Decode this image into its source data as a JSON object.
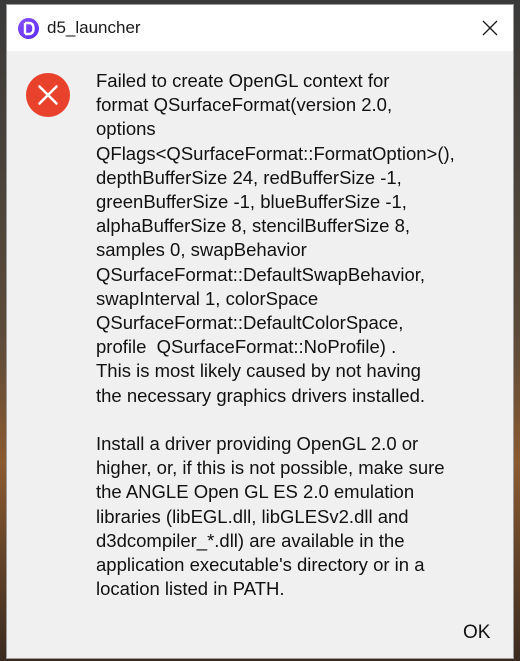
{
  "window": {
    "title": "d5_launcher",
    "app_icon": "d5-launcher-logo-icon",
    "close_icon": "close-icon"
  },
  "dialog": {
    "icon": "error-icon",
    "message_paragraph_1": "Failed to create OpenGL context for\nformat QSurfaceFormat(version 2.0,\noptions\nQFlags<QSurfaceFormat::FormatOption>(),\ndepthBufferSize 24, redBufferSize -1,\ngreenBufferSize -1, blueBufferSize -1,\nalphaBufferSize 8, stencilBufferSize 8,\nsamples 0, swapBehavior\nQSurfaceFormat::DefaultSwapBehavior,\nswapInterval 1, colorSpace\nQSurfaceFormat::DefaultColorSpace,\nprofile  QSurfaceFormat::NoProfile) .\nThis is most likely caused by not having\nthe necessary graphics drivers installed.",
    "message_paragraph_2": "Install a driver providing OpenGL 2.0 or\nhigher, or, if this is not possible, make sure\nthe ANGLE Open GL ES 2.0 emulation\nlibraries (libEGL.dll, libGLESv2.dll and\nd3dcompiler_*.dll) are available in the\napplication executable's directory or in a\nlocation listed in PATH.",
    "ok_label": "OK"
  },
  "colors": {
    "error_red": "#e8412c",
    "dialog_bg": "#f0f0f0",
    "titlebar_bg": "#ffffff",
    "accent_purple": "#6a35f5"
  }
}
